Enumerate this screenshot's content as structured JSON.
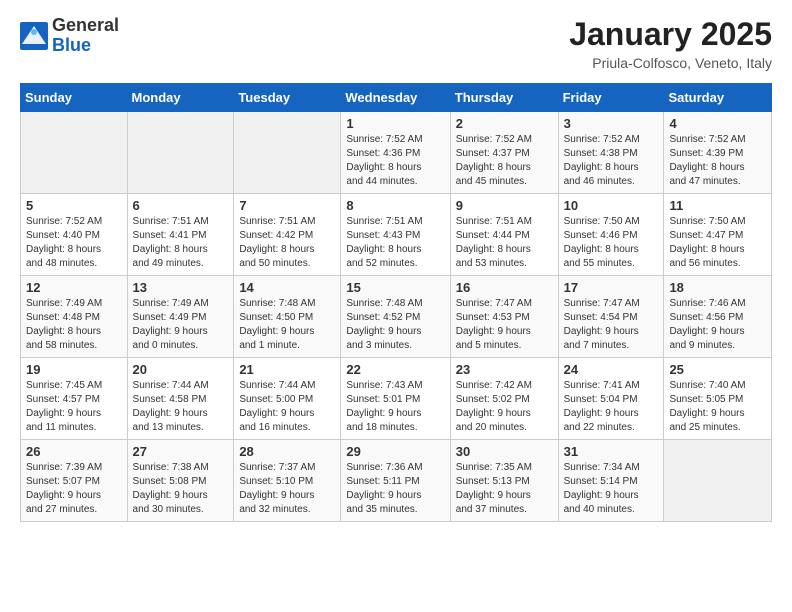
{
  "header": {
    "logo_general": "General",
    "logo_blue": "Blue",
    "month_title": "January 2025",
    "subtitle": "Priula-Colfosco, Veneto, Italy"
  },
  "weekdays": [
    "Sunday",
    "Monday",
    "Tuesday",
    "Wednesday",
    "Thursday",
    "Friday",
    "Saturday"
  ],
  "weeks": [
    [
      {
        "day": "",
        "info": ""
      },
      {
        "day": "",
        "info": ""
      },
      {
        "day": "",
        "info": ""
      },
      {
        "day": "1",
        "info": "Sunrise: 7:52 AM\nSunset: 4:36 PM\nDaylight: 8 hours\nand 44 minutes."
      },
      {
        "day": "2",
        "info": "Sunrise: 7:52 AM\nSunset: 4:37 PM\nDaylight: 8 hours\nand 45 minutes."
      },
      {
        "day": "3",
        "info": "Sunrise: 7:52 AM\nSunset: 4:38 PM\nDaylight: 8 hours\nand 46 minutes."
      },
      {
        "day": "4",
        "info": "Sunrise: 7:52 AM\nSunset: 4:39 PM\nDaylight: 8 hours\nand 47 minutes."
      }
    ],
    [
      {
        "day": "5",
        "info": "Sunrise: 7:52 AM\nSunset: 4:40 PM\nDaylight: 8 hours\nand 48 minutes."
      },
      {
        "day": "6",
        "info": "Sunrise: 7:51 AM\nSunset: 4:41 PM\nDaylight: 8 hours\nand 49 minutes."
      },
      {
        "day": "7",
        "info": "Sunrise: 7:51 AM\nSunset: 4:42 PM\nDaylight: 8 hours\nand 50 minutes."
      },
      {
        "day": "8",
        "info": "Sunrise: 7:51 AM\nSunset: 4:43 PM\nDaylight: 8 hours\nand 52 minutes."
      },
      {
        "day": "9",
        "info": "Sunrise: 7:51 AM\nSunset: 4:44 PM\nDaylight: 8 hours\nand 53 minutes."
      },
      {
        "day": "10",
        "info": "Sunrise: 7:50 AM\nSunset: 4:46 PM\nDaylight: 8 hours\nand 55 minutes."
      },
      {
        "day": "11",
        "info": "Sunrise: 7:50 AM\nSunset: 4:47 PM\nDaylight: 8 hours\nand 56 minutes."
      }
    ],
    [
      {
        "day": "12",
        "info": "Sunrise: 7:49 AM\nSunset: 4:48 PM\nDaylight: 8 hours\nand 58 minutes."
      },
      {
        "day": "13",
        "info": "Sunrise: 7:49 AM\nSunset: 4:49 PM\nDaylight: 9 hours\nand 0 minutes."
      },
      {
        "day": "14",
        "info": "Sunrise: 7:48 AM\nSunset: 4:50 PM\nDaylight: 9 hours\nand 1 minute."
      },
      {
        "day": "15",
        "info": "Sunrise: 7:48 AM\nSunset: 4:52 PM\nDaylight: 9 hours\nand 3 minutes."
      },
      {
        "day": "16",
        "info": "Sunrise: 7:47 AM\nSunset: 4:53 PM\nDaylight: 9 hours\nand 5 minutes."
      },
      {
        "day": "17",
        "info": "Sunrise: 7:47 AM\nSunset: 4:54 PM\nDaylight: 9 hours\nand 7 minutes."
      },
      {
        "day": "18",
        "info": "Sunrise: 7:46 AM\nSunset: 4:56 PM\nDaylight: 9 hours\nand 9 minutes."
      }
    ],
    [
      {
        "day": "19",
        "info": "Sunrise: 7:45 AM\nSunset: 4:57 PM\nDaylight: 9 hours\nand 11 minutes."
      },
      {
        "day": "20",
        "info": "Sunrise: 7:44 AM\nSunset: 4:58 PM\nDaylight: 9 hours\nand 13 minutes."
      },
      {
        "day": "21",
        "info": "Sunrise: 7:44 AM\nSunset: 5:00 PM\nDaylight: 9 hours\nand 16 minutes."
      },
      {
        "day": "22",
        "info": "Sunrise: 7:43 AM\nSunset: 5:01 PM\nDaylight: 9 hours\nand 18 minutes."
      },
      {
        "day": "23",
        "info": "Sunrise: 7:42 AM\nSunset: 5:02 PM\nDaylight: 9 hours\nand 20 minutes."
      },
      {
        "day": "24",
        "info": "Sunrise: 7:41 AM\nSunset: 5:04 PM\nDaylight: 9 hours\nand 22 minutes."
      },
      {
        "day": "25",
        "info": "Sunrise: 7:40 AM\nSunset: 5:05 PM\nDaylight: 9 hours\nand 25 minutes."
      }
    ],
    [
      {
        "day": "26",
        "info": "Sunrise: 7:39 AM\nSunset: 5:07 PM\nDaylight: 9 hours\nand 27 minutes."
      },
      {
        "day": "27",
        "info": "Sunrise: 7:38 AM\nSunset: 5:08 PM\nDaylight: 9 hours\nand 30 minutes."
      },
      {
        "day": "28",
        "info": "Sunrise: 7:37 AM\nSunset: 5:10 PM\nDaylight: 9 hours\nand 32 minutes."
      },
      {
        "day": "29",
        "info": "Sunrise: 7:36 AM\nSunset: 5:11 PM\nDaylight: 9 hours\nand 35 minutes."
      },
      {
        "day": "30",
        "info": "Sunrise: 7:35 AM\nSunset: 5:13 PM\nDaylight: 9 hours\nand 37 minutes."
      },
      {
        "day": "31",
        "info": "Sunrise: 7:34 AM\nSunset: 5:14 PM\nDaylight: 9 hours\nand 40 minutes."
      },
      {
        "day": "",
        "info": ""
      }
    ]
  ]
}
